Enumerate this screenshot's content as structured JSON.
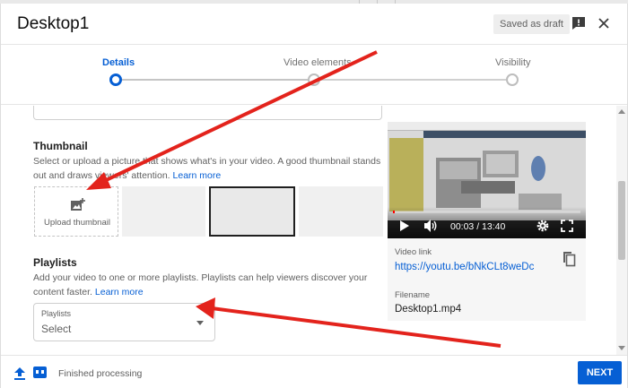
{
  "dialog": {
    "title": "Desktop1",
    "draft_badge": "Saved as draft"
  },
  "stepper": {
    "steps": [
      {
        "label": "Details",
        "state": "active"
      },
      {
        "label": "Video elements",
        "state": "pending"
      },
      {
        "label": "Visibility",
        "state": "pending"
      }
    ]
  },
  "thumbnail": {
    "title": "Thumbnail",
    "description": "Select or upload a picture that shows what's in your video. A good thumbnail stands out and draws viewers' attention.",
    "learn_more": "Learn more",
    "upload_label": "Upload thumbnail"
  },
  "playlists": {
    "title": "Playlists",
    "description": "Add your video to one or more playlists. Playlists can help viewers discover your content faster.",
    "learn_more": "Learn more",
    "select_label": "Playlists",
    "select_value": "Select"
  },
  "video": {
    "current_time": "00:03",
    "duration": "13:40",
    "time_display": "00:03 / 13:40",
    "progress": 0.004,
    "link_label": "Video link",
    "link": "https://youtu.be/bNkCLt8weDc",
    "filename_label": "Filename",
    "filename": "Desktop1.mp4"
  },
  "footer": {
    "status": "Finished processing",
    "next_label": "NEXT"
  },
  "colors": {
    "accent": "#065fd4",
    "annotation_arrow": "#e3231c"
  }
}
